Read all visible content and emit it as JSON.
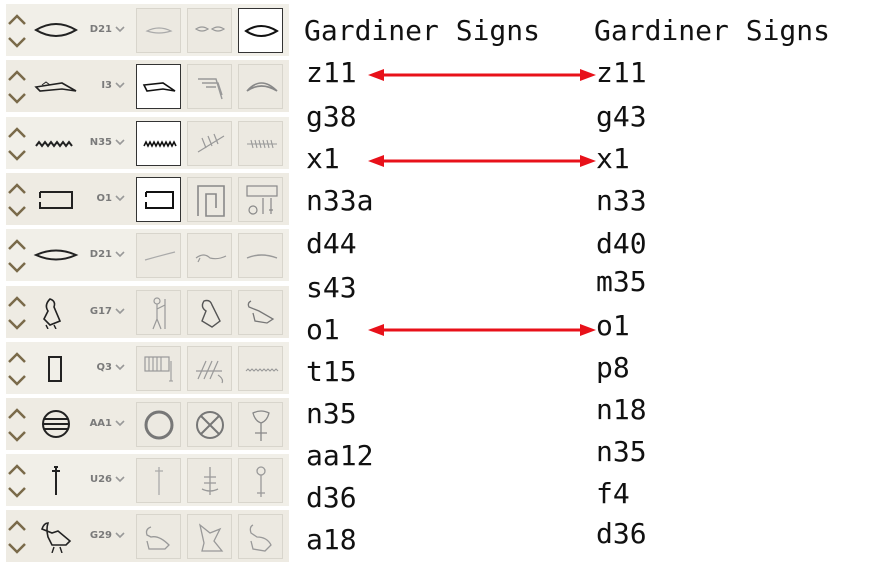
{
  "left_panel": {
    "rows": [
      {
        "code": "D21",
        "glyph": "eye-glyph-icon",
        "candidates": [
          "eye-faint-icon",
          "eyes-pair-icon",
          "eye-icon"
        ],
        "selected": 2
      },
      {
        "code": "I3",
        "glyph": "crocodile-glyph-icon",
        "candidates": [
          "crocodile-icon",
          "stairs-icon",
          "arc-icon"
        ],
        "selected": 0
      },
      {
        "code": "N35",
        "glyph": "water-ripple-glyph-icon",
        "candidates": [
          "water-ripple-icon",
          "reeds-icon",
          "fish-bone-icon"
        ],
        "selected": 0
      },
      {
        "code": "O1",
        "glyph": "house-plan-glyph-icon",
        "candidates": [
          "house-plan-icon",
          "spiral-icon",
          "vessels-icon"
        ],
        "selected": 0
      },
      {
        "code": "D21",
        "glyph": "mouth-glyph-icon",
        "candidates": [
          "line-faint-icon",
          "bird-flat-icon",
          "arc-line-icon"
        ],
        "selected": -1
      },
      {
        "code": "G17",
        "glyph": "owl-glyph-icon",
        "candidates": [
          "man-staff-icon",
          "bird-icon",
          "ibis-icon"
        ],
        "selected": -1
      },
      {
        "code": "Q3",
        "glyph": "stool-glyph-icon",
        "candidates": [
          "comb-icon",
          "hatch-icon",
          "water-line-icon"
        ],
        "selected": -1
      },
      {
        "code": "AA1",
        "glyph": "placenta-glyph-icon",
        "candidates": [
          "ring-icon",
          "crossed-circle-icon",
          "heart-vase-icon"
        ],
        "selected": -1
      },
      {
        "code": "U26",
        "glyph": "drill-glyph-icon",
        "candidates": [
          "drill-faint-icon",
          "plant-icon",
          "ankh-stick-icon"
        ],
        "selected": -1
      },
      {
        "code": "G29",
        "glyph": "ibis-glyph-icon",
        "candidates": [
          "duck-icon",
          "bird-wings-icon",
          "duck-standing-icon"
        ],
        "selected": -1
      }
    ]
  },
  "columns": {
    "left_header": "Gardiner Signs",
    "right_header": "Gardiner Signs",
    "left_values": [
      "z11",
      "g38",
      "x1",
      "n33a",
      "d44",
      "s43",
      "o1",
      "t15",
      "n35",
      "aa12",
      "d36",
      "a18"
    ],
    "right_values": [
      "z11",
      "g43",
      "x1",
      "n33",
      "d40",
      "m35",
      "o1",
      "p8",
      "n18",
      "n35",
      "f4",
      "d36"
    ],
    "arrow_rows": [
      0,
      2,
      6
    ],
    "arrow_color": "#e8111a"
  }
}
